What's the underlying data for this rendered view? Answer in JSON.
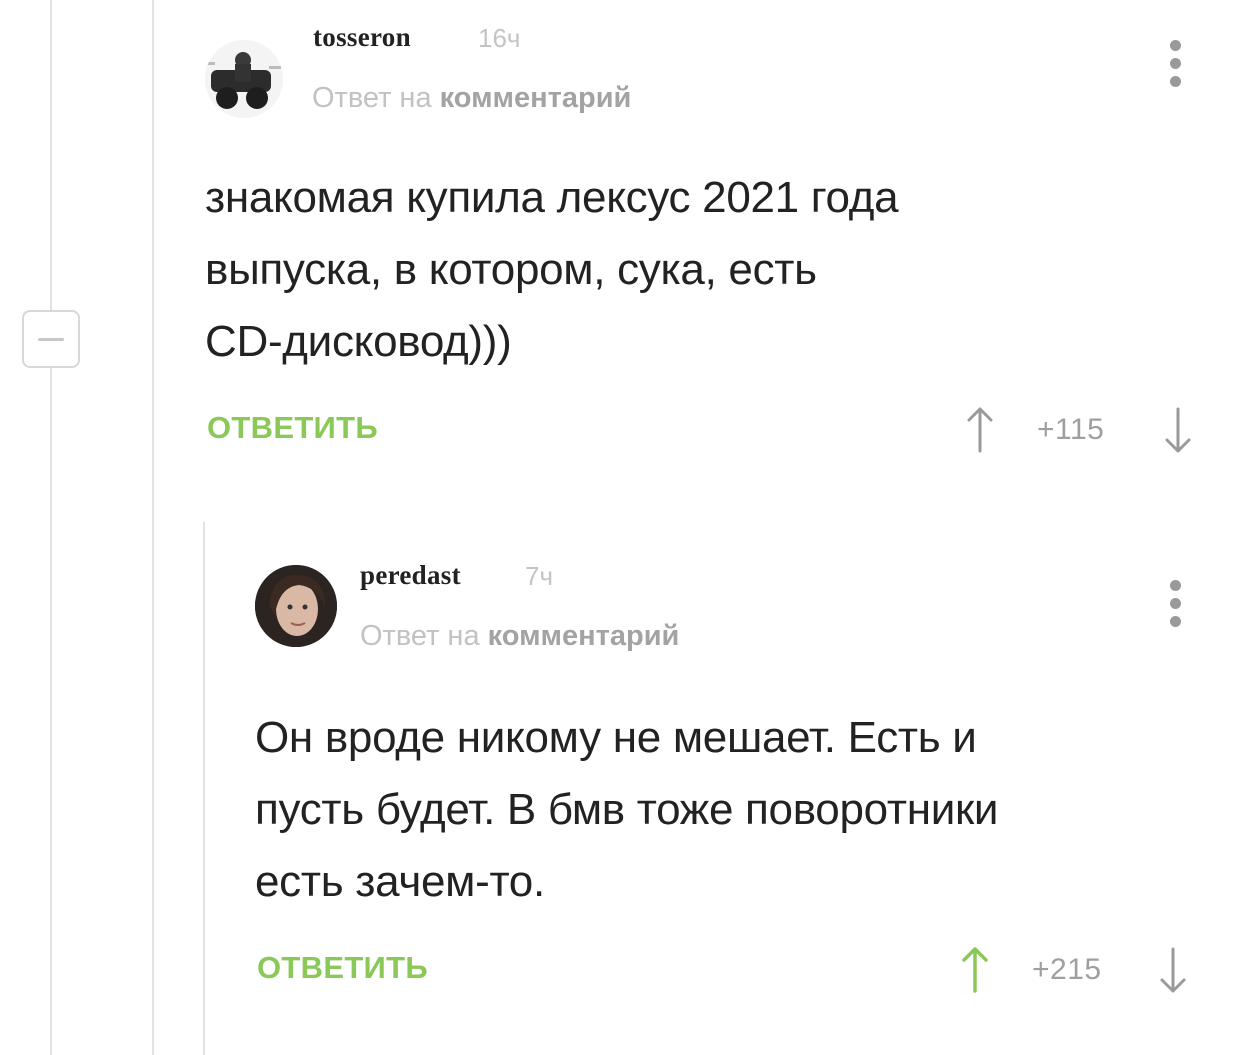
{
  "thread": {
    "collapse_icon": "minus-icon"
  },
  "comments": [
    {
      "author": "tosseron",
      "time": "16ч",
      "reply_prefix": "Ответ на",
      "reply_link": "комментарий",
      "text_lines": [
        "знакомая купила лексус 2021 года",
        "выпуска, в котором, сука, есть",
        "CD-дисковод)))"
      ],
      "reply_label": "ОТВЕТИТЬ",
      "rating": "+115",
      "upvote_color": "#9a9a9a",
      "menu_icon": "kebab-menu-icon"
    },
    {
      "author": "peredast",
      "time": "7ч",
      "reply_prefix": "Ответ на",
      "reply_link": "комментарий",
      "text_lines": [
        "Он вроде никому не мешает. Есть и",
        "пусть будет. В бмв тоже поворотники",
        "есть зачем-то."
      ],
      "reply_label": "ОТВЕТИТЬ",
      "rating": "+215",
      "upvote_color": "#8ac858",
      "menu_icon": "kebab-menu-icon"
    }
  ],
  "colors": {
    "accent_green": "#8ac858",
    "muted_gray": "#9a9a9a",
    "thread_line": "#e3e3e3"
  }
}
